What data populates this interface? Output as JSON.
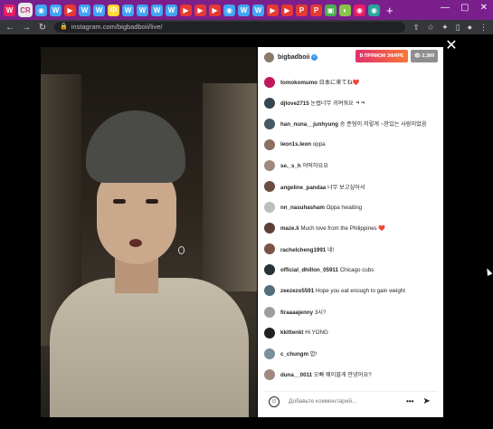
{
  "browser": {
    "tabs": [
      {
        "label": "W",
        "color": "#e91e63"
      },
      {
        "label": "CR",
        "color": "#f48fb1"
      },
      {
        "label": "◉",
        "color": "#42a5f5"
      },
      {
        "label": "W",
        "color": "#42a5f5"
      },
      {
        "label": "▶",
        "color": "#e53935"
      },
      {
        "label": "W",
        "color": "#42a5f5"
      },
      {
        "label": "W",
        "color": "#42a5f5"
      },
      {
        "label": "中",
        "color": "#fdd835"
      },
      {
        "label": "W",
        "color": "#42a5f5"
      },
      {
        "label": "W",
        "color": "#42a5f5"
      },
      {
        "label": "W",
        "color": "#42a5f5"
      },
      {
        "label": "W",
        "color": "#42a5f5"
      },
      {
        "label": "▶",
        "color": "#e53935"
      },
      {
        "label": "▶",
        "color": "#e53935"
      },
      {
        "label": "▶",
        "color": "#e53935"
      },
      {
        "label": "◉",
        "color": "#42a5f5"
      },
      {
        "label": "W",
        "color": "#42a5f5"
      },
      {
        "label": "W",
        "color": "#42a5f5"
      },
      {
        "label": "▶",
        "color": "#e53935"
      },
      {
        "label": "▶",
        "color": "#e53935"
      },
      {
        "label": "P",
        "color": "#e53935"
      },
      {
        "label": "P",
        "color": "#e53935"
      },
      {
        "label": "▣",
        "color": "#4caf50"
      },
      {
        "label": "◐",
        "color": "#8bc34a"
      },
      {
        "label": "◉",
        "color": "#e91e63"
      },
      {
        "label": "◉",
        "color": "#26a69a"
      }
    ],
    "active_tab": "CR",
    "new_tab": "+",
    "url": "instagram.com/bigbadboii/live/"
  },
  "live": {
    "username": "bigbadboii",
    "live_badge": "В ПРЯМОМ ЭФИРЕ",
    "viewers": "👁 2,389",
    "close": "✕"
  },
  "comments": [
    {
      "user": "tomokomumo",
      "text": "日本に来てね❤️",
      "avatar_color": "#c2185b"
    },
    {
      "user": "djlove2715",
      "text": "눈썹너무 귀여워요 ㅋㅋ",
      "avatar_color": "#37474f"
    },
    {
      "user": "han_nuna__junhyung",
      "text": "승 준형이 저렇게 ~한있는 사람이었음",
      "avatar_color": "#455a64"
    },
    {
      "user": "leon1s.leon",
      "text": "oppa",
      "avatar_color": "#8d6e63"
    },
    {
      "user": "se._s_h",
      "text": "어떡하요요",
      "avatar_color": "#a1887f"
    },
    {
      "user": "angeline_pandaa",
      "text": "너무 보고싶어서",
      "avatar_color": "#6d4c41"
    },
    {
      "user": "nn_nasuhasham",
      "text": "Oppa hwaiting",
      "avatar_color": "#bdbdbd"
    },
    {
      "user": "maze.li",
      "text": "Much love from the Philippines ❤️",
      "avatar_color": "#5d4037"
    },
    {
      "user": "rachelcheng1991",
      "text": "네!",
      "avatar_color": "#795548"
    },
    {
      "user": "official_dhillon_05911",
      "text": "Chicago cubs",
      "avatar_color": "#263238"
    },
    {
      "user": "zeezezo5591",
      "text": "Hope you eat enough to gain weight",
      "avatar_color": "#546e7a"
    },
    {
      "user": "firaaaajenny",
      "text": "3시?",
      "avatar_color": "#9e9e9e"
    },
    {
      "user": "kkittenkt",
      "text": "Hi YONG",
      "avatar_color": "#212121"
    },
    {
      "user": "c_chungm",
      "text": "밥!",
      "avatar_color": "#78909c"
    },
    {
      "user": "duna__0011",
      "text": "오빠 웨이블게 안녕어요?",
      "avatar_color": "#a1887f"
    }
  ],
  "composer": {
    "emoji": "☺",
    "placeholder": "Добавьте комментарий...",
    "more": "•••",
    "send": "➤"
  }
}
